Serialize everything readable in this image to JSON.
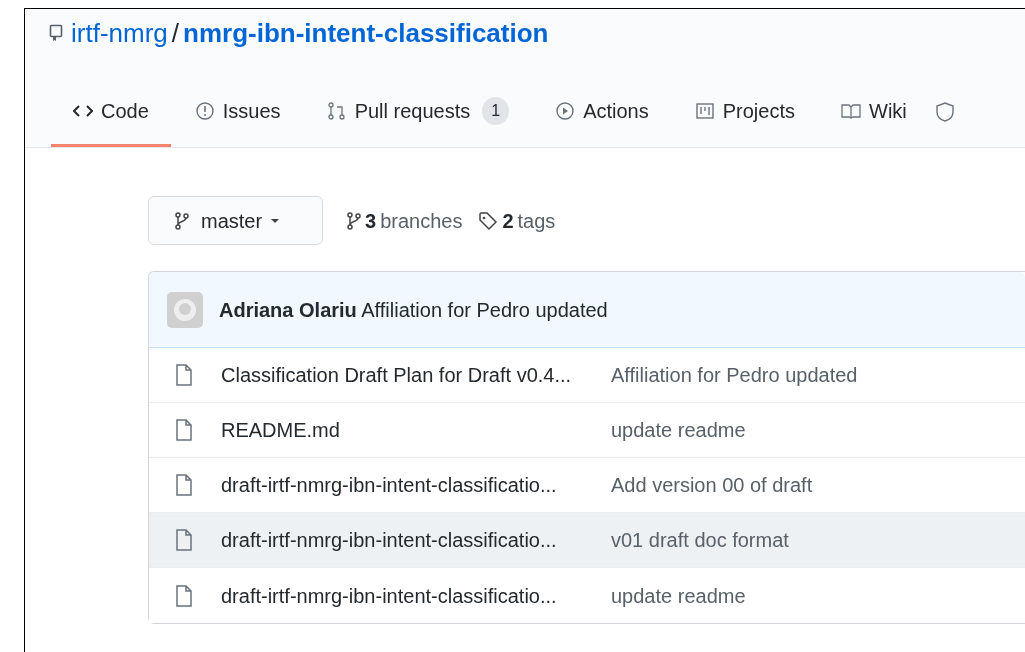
{
  "repo": {
    "owner": "irtf-nmrg",
    "separator": "/",
    "name": "nmrg-ibn-intent-classification"
  },
  "tabs": [
    {
      "label": "Code",
      "selected": true
    },
    {
      "label": "Issues",
      "selected": false
    },
    {
      "label": "Pull requests",
      "count": "1",
      "selected": false
    },
    {
      "label": "Actions",
      "selected": false
    },
    {
      "label": "Projects",
      "selected": false
    },
    {
      "label": "Wiki",
      "selected": false
    }
  ],
  "branch": {
    "name": "master"
  },
  "branches": {
    "count": "3",
    "label": "branches"
  },
  "tags": {
    "count": "2",
    "label": "tags"
  },
  "commit": {
    "author": "Adriana Olariu",
    "message": "Affiliation for Pedro updated"
  },
  "files": [
    {
      "name": "Classification Draft Plan for Draft v0.4...",
      "message": "Affiliation for Pedro updated",
      "highlighted": false
    },
    {
      "name": "README.md",
      "message": "update readme",
      "highlighted": false
    },
    {
      "name": "draft-irtf-nmrg-ibn-intent-classificatio...",
      "message": "Add version 00 of draft",
      "highlighted": false
    },
    {
      "name": "draft-irtf-nmrg-ibn-intent-classificatio...",
      "message": "v01 draft doc format",
      "highlighted": true
    },
    {
      "name": "draft-irtf-nmrg-ibn-intent-classificatio...",
      "message": "update readme",
      "highlighted": false
    }
  ]
}
